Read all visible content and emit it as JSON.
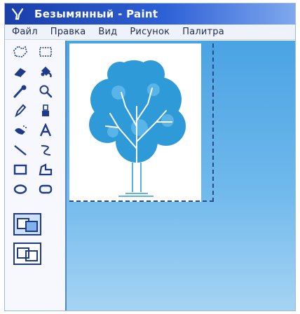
{
  "window": {
    "title": "Безымянный - Paint",
    "app_icon": "paint-app-icon"
  },
  "menu": {
    "items": [
      "Файл",
      "Правка",
      "Вид",
      "Рисунок",
      "Палитра"
    ]
  },
  "toolbox": {
    "tools": [
      "free-form-select-icon",
      "rect-select-icon",
      "eraser-icon",
      "fill-icon",
      "color-picker-icon",
      "magnifier-icon",
      "pencil-icon",
      "brush-icon",
      "airbrush-icon",
      "text-icon",
      "line-icon",
      "curve-icon",
      "rectangle-icon",
      "polygon-icon",
      "ellipse-icon",
      "rounded-rect-icon"
    ],
    "options": [
      "opaque-selection-icon",
      "transparent-selection-icon"
    ]
  },
  "colors": {
    "title_bar": "#2e60d6",
    "toolbox_border": "#4f88d8",
    "canvas_background": "#4aa3e3",
    "tree_color": "#2f9ad8"
  }
}
